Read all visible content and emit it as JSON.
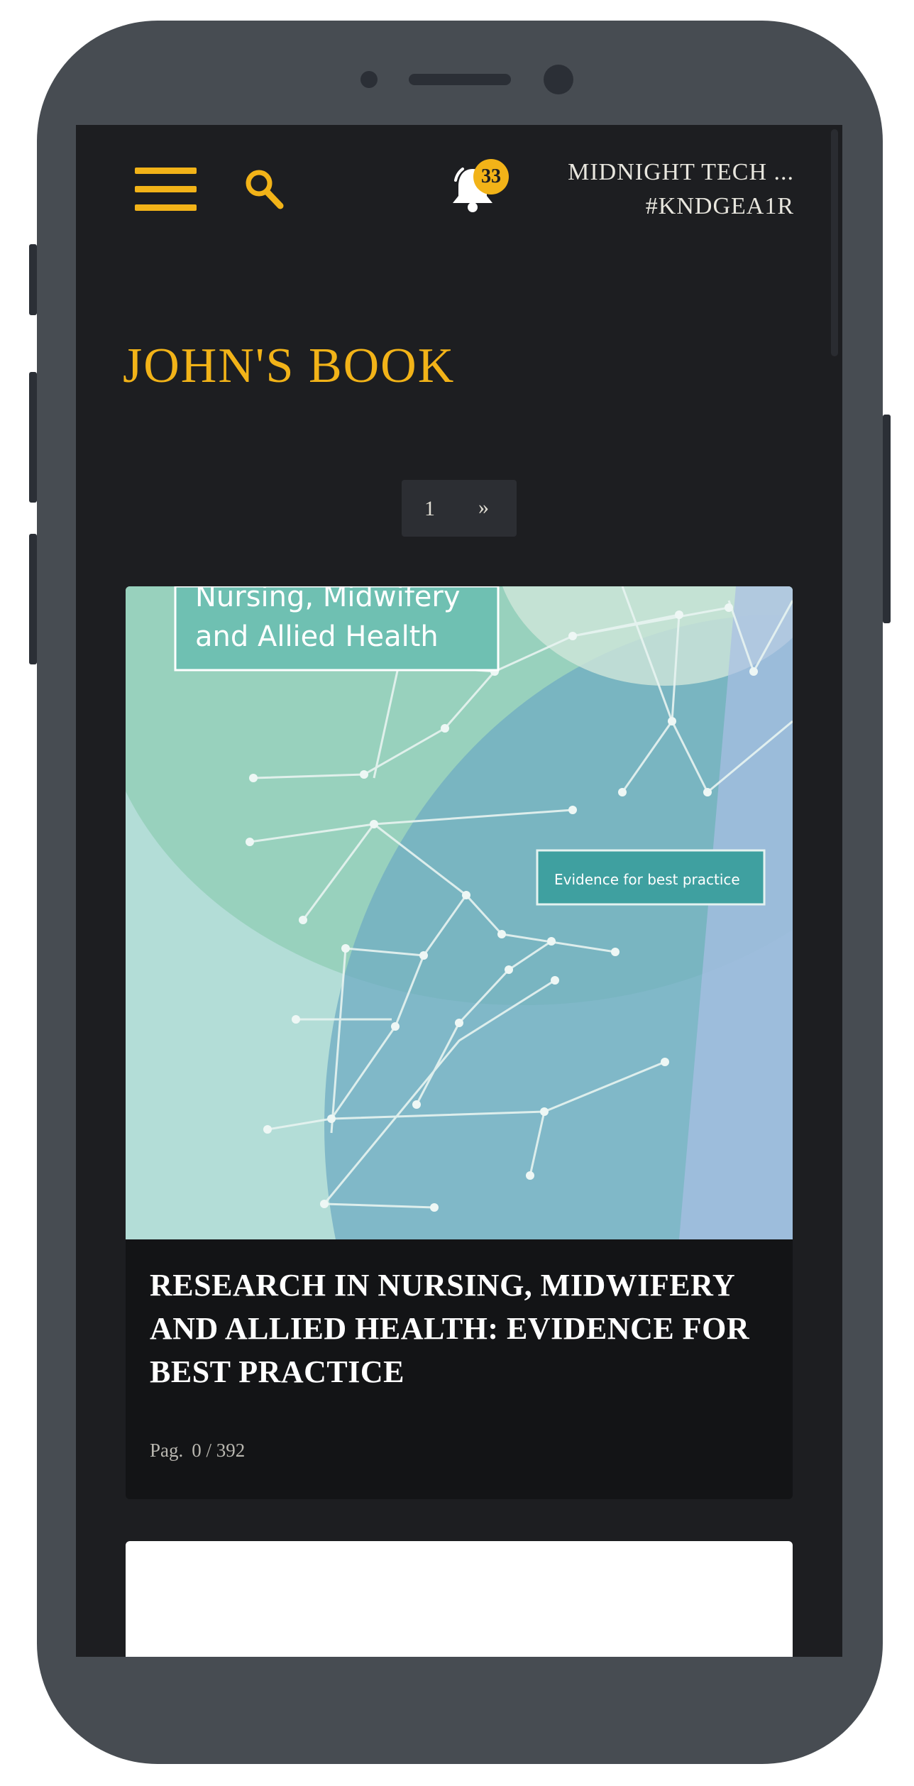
{
  "header": {
    "menu_icon": "hamburger-menu-icon",
    "search_icon": "search-icon",
    "notifications": {
      "icon": "bell-icon",
      "count": "33"
    },
    "user": {
      "name": "MIDNIGHT TECH ...",
      "code": "#KNDGEA1R"
    }
  },
  "page": {
    "title": "JOHN'S BOOK"
  },
  "pagination": {
    "current": "1",
    "next": "»"
  },
  "books": [
    {
      "cover": {
        "heading_line1": "Nursing, Midwifery",
        "heading_line2": "and Allied Health",
        "tag": "Evidence for best practice"
      },
      "title": "RESEARCH IN NURSING, MIDWIFERY AND ALLIED HEALTH: EVIDENCE FOR BEST PRACTICE",
      "pages_label": "Pag.",
      "pages_value": "0 / 392"
    }
  ],
  "colors": {
    "accent": "#f2b318",
    "background": "#1d1e21",
    "card": "#131416"
  }
}
